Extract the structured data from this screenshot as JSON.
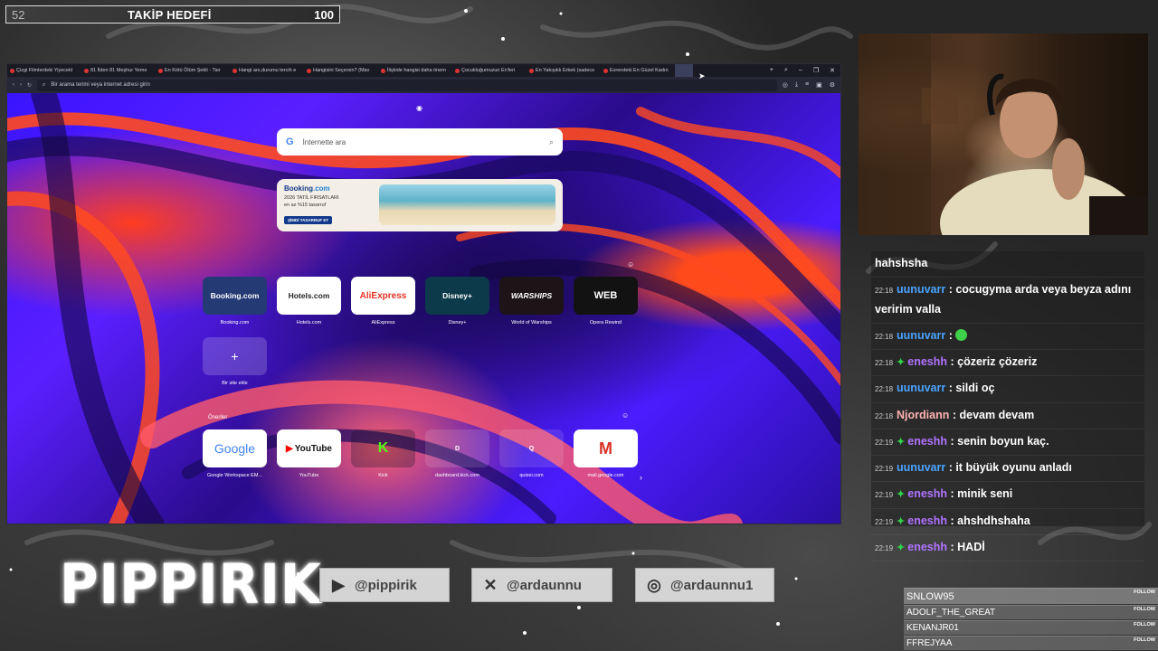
{
  "goal": {
    "current": "52",
    "title": "TAKİP HEDEFİ",
    "target": "100"
  },
  "browser": {
    "tabs": [
      "Çizgi Filmlerdeki Yiyecekl",
      "81 İlden 81 Meşhur Yeme",
      "En Kötü Ölüm Şekli - Tier",
      "Hangi anı,durumu tercih e",
      "Hangisini Seçersin? (Mav",
      "İlişkide hangisi daha önem",
      "Çocukluğumuzun En'leri",
      "En Yakışıklı Erkek (sadece",
      "Evrendeki En Güzel Kadın"
    ],
    "address_placeholder": "Bir arama terimi veya internet adresi girin",
    "search_placeholder": "İnternette ara",
    "ad": {
      "brand": "Booking",
      "brand_suffix": ".com",
      "line1": "2026 TATİL FIRSATLARI",
      "line2": "en az %15 tasarruf",
      "cta": "ŞİMDİ TASARRUF ET"
    },
    "speed_dials": [
      {
        "tile": "Booking.com",
        "label": "Booking.com"
      },
      {
        "tile": "Hotels.com",
        "label": "Hotels.com"
      },
      {
        "tile": "AliExpress",
        "label": "AliExpress"
      },
      {
        "tile": "Disney+",
        "label": "Disney+"
      },
      {
        "tile": "WARSHIPS",
        "label": "World of Warships"
      },
      {
        "tile": "WEB",
        "label": "Opera Rewind"
      },
      {
        "tile": "+",
        "label": "Bir site ekle"
      }
    ],
    "suggestions_title": "Öneriler",
    "suggestions": [
      {
        "tile": "Google",
        "label": "Google Workspace EM..."
      },
      {
        "tile": "YouTube",
        "label": "YouTube"
      },
      {
        "tile": "K",
        "label": "Kick"
      },
      {
        "tile": "D",
        "label": "dashboard.kick.com"
      },
      {
        "tile": "Q",
        "label": "quizei.com"
      },
      {
        "tile": "M",
        "label": "mail.google.com"
      }
    ]
  },
  "chat": {
    "header": "hahshsha",
    "messages": [
      {
        "time": "22:18",
        "user": "uunuvarr",
        "text": ": cocugyma arda veya beyza adını veririm valla",
        "color": "blue",
        "badge": false
      },
      {
        "time": "22:18",
        "user": "uunuvarr",
        "text": ":",
        "color": "blue",
        "badge": false,
        "emote": true
      },
      {
        "time": "22:18",
        "user": "eneshh",
        "text": ": çözeriz çözeriz",
        "color": "purple",
        "badge": true
      },
      {
        "time": "22:18",
        "user": "uunuvarr",
        "text": ": sildi oç",
        "color": "blue",
        "badge": false
      },
      {
        "time": "22:18",
        "user": "Njordiann",
        "text": ": devam devam",
        "color": "pink",
        "badge": false
      },
      {
        "time": "22:19",
        "user": "eneshh",
        "text": ": senin boyun kaç.",
        "color": "purple",
        "badge": true
      },
      {
        "time": "22:19",
        "user": "uunuvarr",
        "text": ": it büyük oyunu anladı",
        "color": "blue",
        "badge": false
      },
      {
        "time": "22:19",
        "user": "eneshh",
        "text": ": minik seni",
        "color": "purple",
        "badge": true
      },
      {
        "time": "22:19",
        "user": "eneshh",
        "text": ": ahshdhshaha",
        "color": "purple",
        "badge": true
      },
      {
        "time": "22:19",
        "user": "eneshh",
        "text": ": HADİ",
        "color": "purple",
        "badge": true
      }
    ]
  },
  "logo": "PIPPIRIK",
  "socials": [
    {
      "icon": "youtube-icon",
      "handle": "@pippirik"
    },
    {
      "icon": "x-icon",
      "handle": "@ardaunnu"
    },
    {
      "icon": "instagram-icon",
      "handle": "@ardaunnu1"
    }
  ],
  "followers": {
    "tag": "FOLLOW",
    "names": [
      "SNLOW95",
      "ADOLF_THE_GREAT",
      "KENANJR01",
      "FFREJYAA"
    ]
  }
}
